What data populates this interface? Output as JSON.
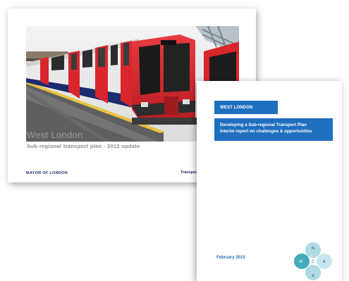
{
  "back_cover": {
    "title": "West London",
    "subtitle": "Sub-regional transport plan - 2012 update",
    "mayor_logo_text": "MAYOR OF LONDON",
    "tfl_logo_text": "Transport",
    "photo_icon": "train-photo"
  },
  "front_cover": {
    "region_label": "WEST LONDON",
    "title_line_1": "Developing a Sub-regional Transport Plan",
    "title_line_2": "Interim report on challenges & opportunities",
    "date": "February 2010",
    "compass": {
      "n": "N",
      "w": "W",
      "c": "C",
      "e": "E",
      "s": "S"
    }
  },
  "colors": {
    "accent_blue": "#1f6fbf",
    "train_red": "#d9262c",
    "mayor_navy": "#1e2f6e"
  }
}
